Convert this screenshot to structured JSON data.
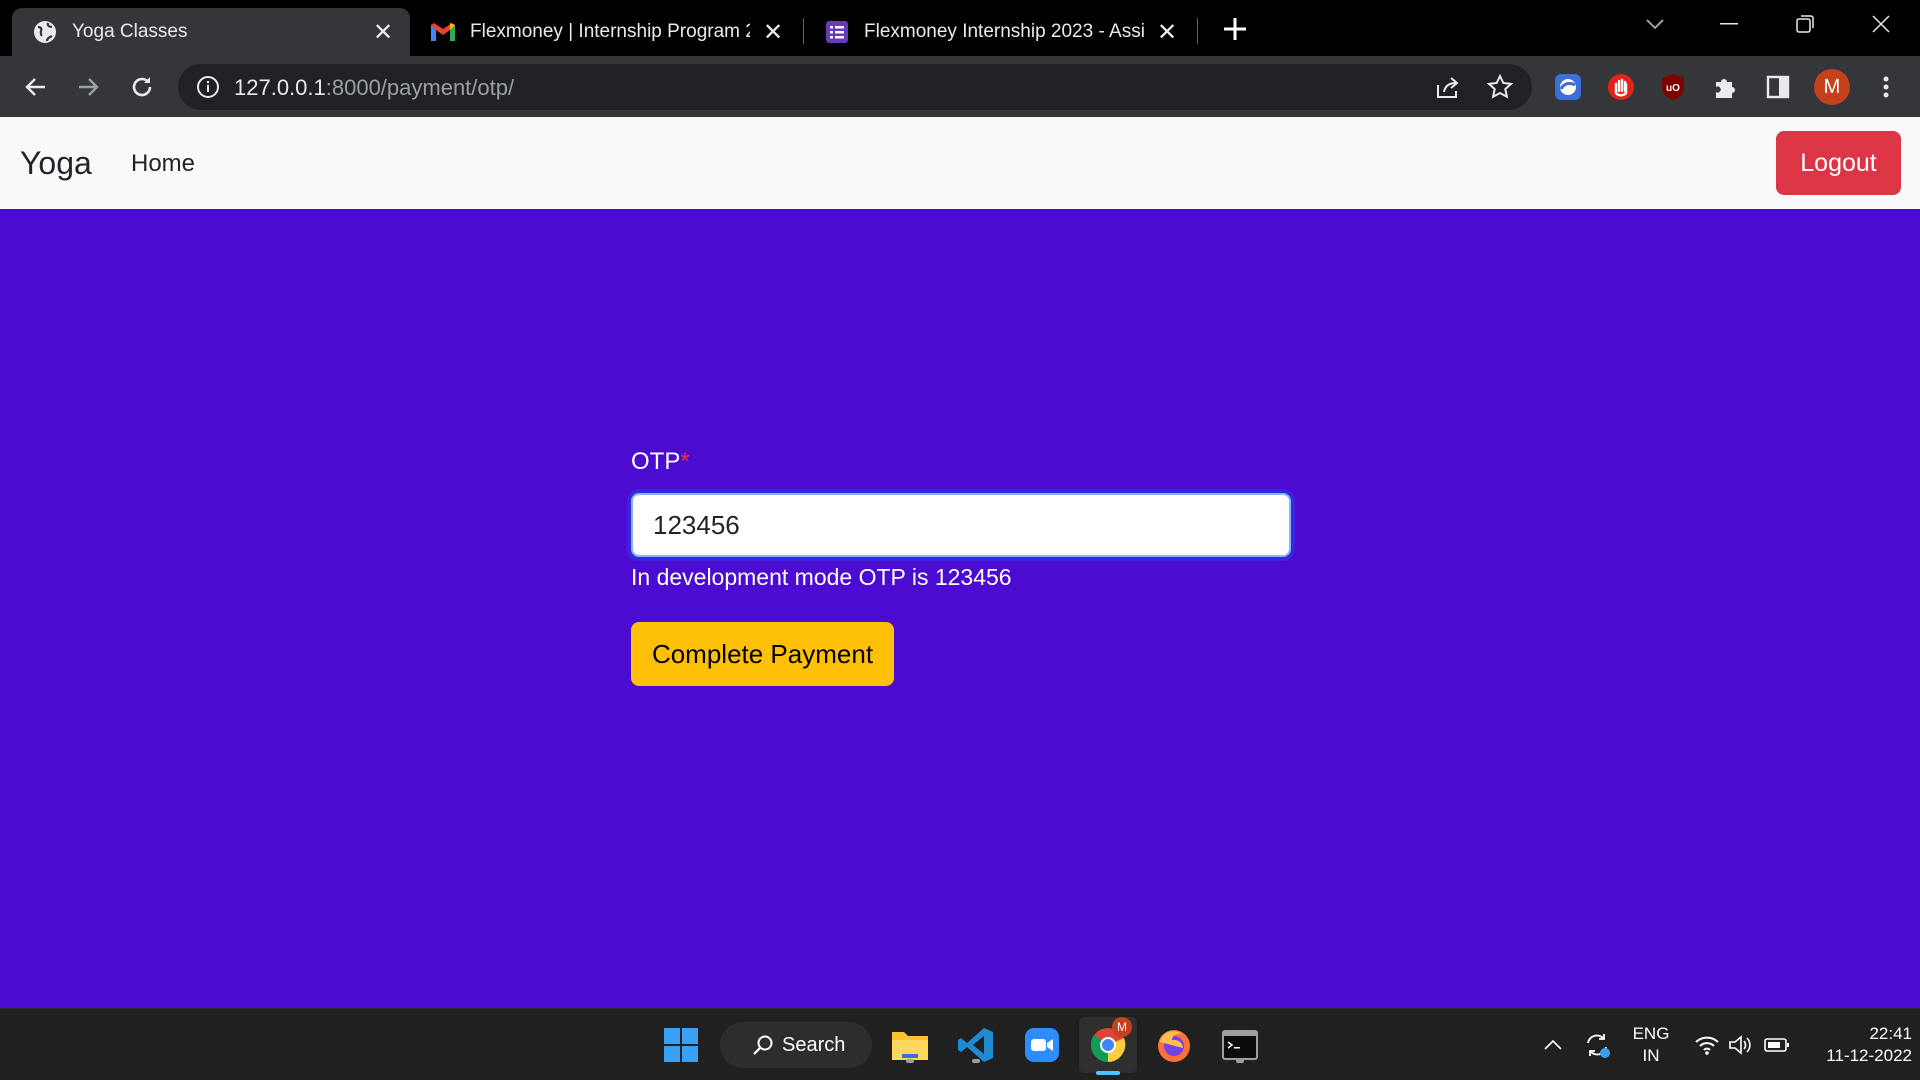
{
  "browser": {
    "tabs": [
      {
        "title": "Yoga Classes",
        "active": true,
        "icon": "globe-icon"
      },
      {
        "title": "Flexmoney | Internship Program 2",
        "active": false,
        "icon": "gmail-icon"
      },
      {
        "title": "Flexmoney Internship 2023 - Assi",
        "active": false,
        "icon": "google-forms-icon"
      }
    ],
    "url_host": "127.0.0.1",
    "url_rest": ":8000/payment/otp/",
    "profile_initial": "M"
  },
  "navbar": {
    "brand": "Yoga",
    "home": "Home",
    "logout": "Logout"
  },
  "form": {
    "label": "OTP",
    "required_mark": "*",
    "otp_value": "123456",
    "help_text": "In development mode OTP is 123456",
    "submit": "Complete Payment"
  },
  "taskbar": {
    "search": "Search",
    "lang_top": "ENG",
    "lang_bottom": "IN",
    "time": "22:41",
    "date": "11-12-2022",
    "chrome_badge": "M"
  },
  "colors": {
    "page_bg": "#4c0bd1",
    "logout_bg": "#dc3545",
    "submit_bg": "#ffc107"
  }
}
